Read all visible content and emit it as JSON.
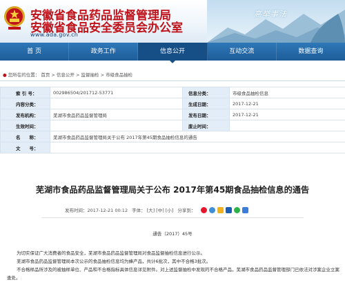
{
  "header": {
    "title_line1": "安徽省食品药品监督管理局",
    "title_line2": "安徽省食品安全委员会办公室",
    "url": "www.ada.gov.cn",
    "slogan": "高举事法",
    "brand_color": "#c0121a"
  },
  "nav": {
    "items": [
      "首 页",
      "政务工作",
      "信息公开",
      "互动交流",
      "数据查询"
    ],
    "active_index": 2,
    "hidden_item": ""
  },
  "breadcrumb": {
    "prefix": "您所在的位置：",
    "items": [
      "首页",
      "信息公开",
      "监督抽检",
      "市级食品抽检"
    ],
    "sep": " > "
  },
  "info": {
    "index_label": "索 引 号：",
    "index_value": "002986504/201712-53771",
    "category_label": "信息分类：",
    "category_value": "市级食品抽检信息",
    "summary_label": "内容分类：",
    "summary_value": "",
    "generated_label": "生成日期：",
    "generated_value": "2017-12-21",
    "issuer_label": "发布机构：",
    "issuer_value": "芜湖市食品药品监督管理局",
    "published_label": "发布日期：",
    "published_value": "2017-12-21",
    "effective_label": "生效时间：",
    "effective_value": "",
    "expire_label": "废止时间：",
    "expire_value": "",
    "name_label": "名　　称：",
    "name_value": "芜湖市食品药品监督管理局关于公布 2017年第45期食品抽检信息的通告",
    "docno_label": "文　　号：",
    "docno_value": ""
  },
  "article": {
    "title": "芜湖市食品药品监督管理局关于公布 2017年第45期食品抽检信息的通告",
    "publish_time_label": "发布时间：2017-12-21 00:12",
    "font_size_label": "字体：",
    "size_large": "[大]",
    "size_medium": "[中]",
    "size_small": "[小]",
    "share_label": "分享到：",
    "doc_number": "通告（2017）45号",
    "paragraphs": [
      "为切实保证广大消费者的食品安全，芜湖市食品药品监督管理局对食品监督抽检信息进行公示。",
      "芜湖市食品药品监督管理局本次公示的食品抽检信息均为蜂产品，共计6批次，其中不合格3批次。",
      "不合格样品所涉及的被抽样单位、产品和不合格指标具体信息详见附件。对上述监督抽检中发现的不合格产品，芜湖市食品药品监督管理部门已依法对涉案企业立案查处。"
    ]
  },
  "share_icons": [
    {
      "name": "sina-weibo-icon",
      "color": "#e6162d"
    },
    {
      "name": "tencent-weibo-icon",
      "color": "#3d8fd6"
    },
    {
      "name": "qzone-icon",
      "color": "#f2b21b"
    },
    {
      "name": "renren-icon",
      "color": "#1a5fb4"
    },
    {
      "name": "wechat-icon",
      "color": "#2db24a"
    },
    {
      "name": "more-share-icon",
      "color": "#3b7dd8"
    }
  ]
}
